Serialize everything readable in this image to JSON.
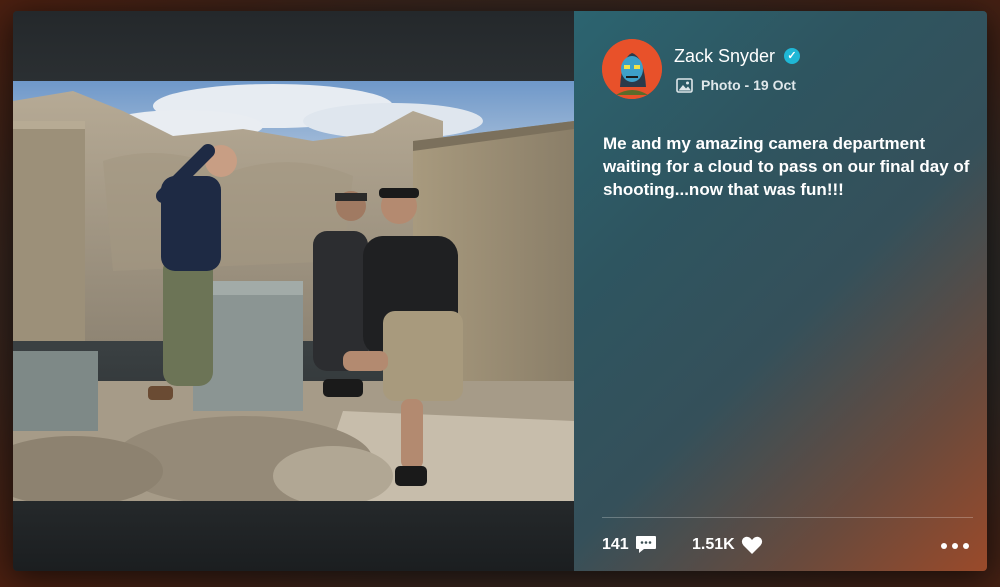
{
  "post": {
    "author": "Zack Snyder",
    "verified": true,
    "type_label": "Photo",
    "date": "19 Oct",
    "meta_separator": " - ",
    "caption": "Me and my amazing camera department waiting for a cloud to pass on our final day of shooting...now that was fun!!!"
  },
  "stats": {
    "comments": "141",
    "likes": "1.51K"
  },
  "icons": {
    "verified": "verified-check-icon",
    "media_type": "photo-icon",
    "comment": "comment-icon",
    "like": "heart-icon",
    "more": "more-options-icon"
  },
  "colors": {
    "verified": "#1fb7d6",
    "avatar_bg": "#e8512a"
  }
}
